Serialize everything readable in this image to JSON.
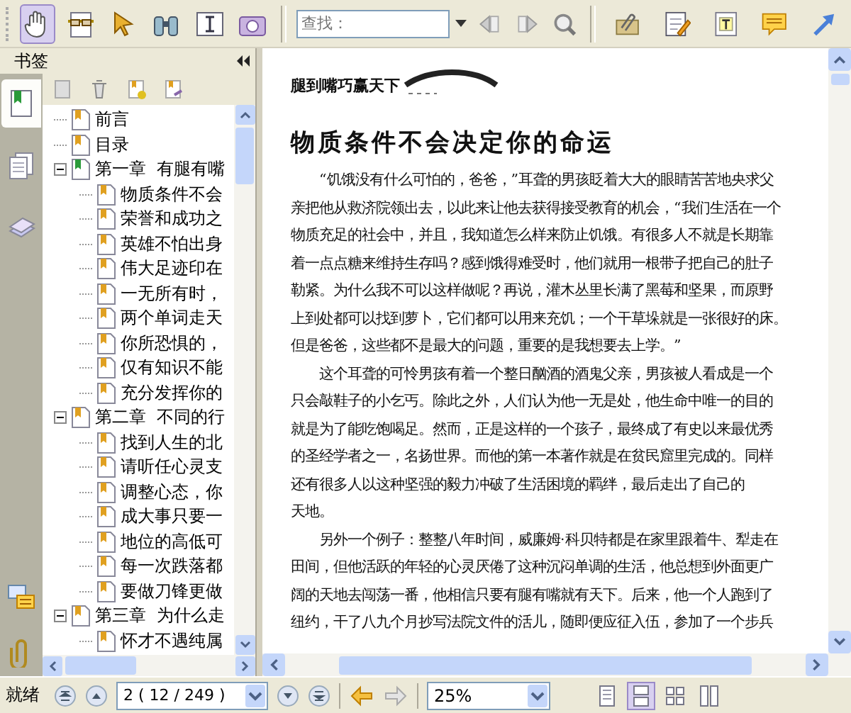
{
  "toolbar": {
    "tools": [
      {
        "kind": "hand",
        "selected": true
      },
      {
        "kind": "reader",
        "selected": false
      },
      {
        "kind": "select",
        "selected": false
      },
      {
        "kind": "binoculars",
        "selected": false
      },
      {
        "kind": "text-select",
        "selected": false
      },
      {
        "kind": "snapshot",
        "selected": false
      }
    ],
    "search": {
      "placeholder": "查找："
    },
    "annotate": [
      {
        "kind": "attach"
      },
      {
        "kind": "note"
      },
      {
        "kind": "typewriter"
      },
      {
        "kind": "comment"
      },
      {
        "kind": "arrow"
      }
    ]
  },
  "sidebar": {
    "title": "书签",
    "panels": [
      {
        "kind": "bookmarks",
        "selected": true
      },
      {
        "kind": "pages",
        "selected": false
      },
      {
        "kind": "layers",
        "selected": false
      }
    ],
    "bookmarks": [
      {
        "label": "前言",
        "current": false
      },
      {
        "label": "目录",
        "current": false
      },
      {
        "label": "第一章  有腿有嘴",
        "current": true,
        "expanded": true,
        "children": [
          {
            "label": "物质条件不会",
            "current": false
          },
          {
            "label": "荣誉和成功之",
            "current": false
          },
          {
            "label": "英雄不怕出身",
            "current": false
          },
          {
            "label": "伟大足迹印在",
            "current": false
          },
          {
            "label": "一无所有时，",
            "current": false
          },
          {
            "label": "两个单词走天",
            "current": false
          },
          {
            "label": "你所恐惧的，",
            "current": false
          },
          {
            "label": "仅有知识不能",
            "current": false
          },
          {
            "label": "充分发挥你的",
            "current": false
          }
        ]
      },
      {
        "label": "第二章  不同的行",
        "current": false,
        "expanded": true,
        "children": [
          {
            "label": "找到人生的北",
            "current": false
          },
          {
            "label": "请听任心灵支",
            "current": false
          },
          {
            "label": "调整心态，你",
            "current": false
          },
          {
            "label": "成大事只要一",
            "current": false
          },
          {
            "label": "地位的高低可",
            "current": false
          },
          {
            "label": "每一次跌落都",
            "current": false
          },
          {
            "label": "要做刀锋更做",
            "current": false
          }
        ]
      },
      {
        "label": "第三章  为什么走",
        "current": false,
        "expanded": true,
        "children": [
          {
            "label": "怀才不遇纯属",
            "current": false
          }
        ]
      }
    ]
  },
  "page": {
    "header": "腿到嘴巧赢天下",
    "title": "物质条件不会决定你的命运",
    "paragraphs": [
      [
        "“饥饿没有什么可怕的，爸爸，”耳聋的男孩眨着大大的眼睛苦苦地央求父",
        "亲把他从救济院领出去，以此来让他去获得接受教育的机会，“我们生活在一个",
        "物质充足的社会中，并且，我知道怎么样来防止饥饿。有很多人不就是长期靠",
        "着一点点糖来维持生存吗？感到饿得难受时，他们就用一根带子把自己的肚子",
        "勒紧。为什么我不可以这样做呢？再说，灌木丛里长满了黑莓和坚果，而原野",
        "上到处都可以找到萝卜，它们都可以用来充饥；一个干草垛就是一张很好的床。",
        "但是爸爸，这些都不是最大的问题，重要的是我想要去上学。”"
      ],
      [
        "这个耳聋的可怜男孩有着一个整日酗酒的酒鬼父亲，男孩被人看成是一个",
        "只会敲鞋子的小乞丐。除此之外，人们认为他一无是处，他生命中唯一的目的",
        "就是为了能吃饱喝足。然而，正是这样的一个孩子，最终成了有史以来最优秀",
        "的圣经学者之一，名扬世界。而他的第一本著作就是在贫民窟里完成的。同样",
        "还有很多人以这种坚强的毅力冲破了生活困境的羁绊，最后走出了自己的",
        "天地。"
      ],
      [
        "另外一个例子：整整八年时间，威廉姆·科贝特都是在家里跟着牛、犁走在",
        "田间，但他活跃的年轻的心灵厌倦了这种沉闷单调的生活，他总想到外面更广",
        "阔的天地去闯荡一番，他相信只要有腿有嘴就有天下。后来，他一个人跑到了",
        "纽约，干了八九个月抄写法院文件的活儿，随即便应征入伍，参加了一个步兵"
      ]
    ]
  },
  "status_bar": {
    "text": "就绪",
    "page_field": "2 ( 12 / 249 )",
    "zoom": "25%",
    "views": [
      {
        "kind": "single",
        "selected": false
      },
      {
        "kind": "continuous",
        "selected": true
      },
      {
        "kind": "facing",
        "selected": false
      },
      {
        "kind": "continuous-facing",
        "selected": false
      }
    ]
  }
}
